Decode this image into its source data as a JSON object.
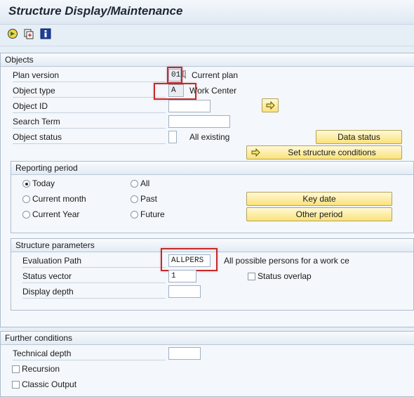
{
  "app": {
    "title": "Structure Display/Maintenance"
  },
  "objects": {
    "header": "Objects",
    "plan_version": {
      "label": "Plan version",
      "value": "01",
      "text": "Current plan"
    },
    "object_type": {
      "label": "Object type",
      "value": "A",
      "text": "Work Center"
    },
    "object_id": {
      "label": "Object ID",
      "value": ""
    },
    "search_term": {
      "label": "Search Term",
      "value": ""
    },
    "object_status": {
      "label": "Object status",
      "value": "",
      "text": "All existing"
    },
    "data_status_btn": "Data status",
    "set_structure_btn": "Set structure conditions"
  },
  "reporting": {
    "header": "Reporting period",
    "today": "Today",
    "current_month": "Current month",
    "current_year": "Current Year",
    "all": "All",
    "past": "Past",
    "future": "Future",
    "key_date_btn": "Key date",
    "other_period_btn": "Other period"
  },
  "structure": {
    "header": "Structure parameters",
    "eval_path": {
      "label": "Evaluation Path",
      "value": "ALLPERS",
      "text": "All possible persons for a work ce"
    },
    "status_vector": {
      "label": "Status vector",
      "value": "1"
    },
    "status_overlap": "Status overlap",
    "display_depth": {
      "label": "Display depth",
      "value": ""
    }
  },
  "further": {
    "header": "Further conditions",
    "technical_depth": {
      "label": "Technical depth",
      "value": ""
    },
    "recursion": "Recursion",
    "classic_output": "Classic Output"
  }
}
